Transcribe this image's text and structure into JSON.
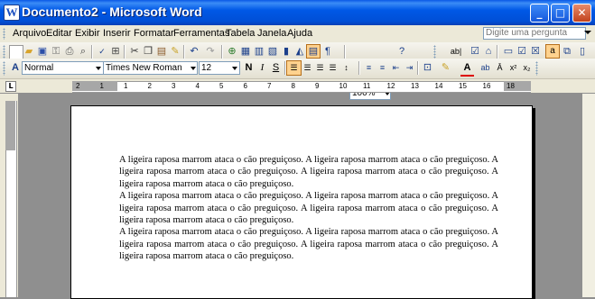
{
  "window": {
    "title": "Documento2 - Microsoft Word",
    "app_icon": "W"
  },
  "menu": {
    "items": [
      "Arquivo",
      "Editar",
      "Exibir",
      "Inserir",
      "Formatar",
      "Ferramentas",
      "Tabela",
      "Janela",
      "Ajuda"
    ],
    "help_placeholder": "Digite uma pergunta"
  },
  "standard_toolbar": {
    "zoom": "100%",
    "leitura": "ab|"
  },
  "formatting_toolbar": {
    "style": "Normal",
    "font": "Times New Roman",
    "size": "12",
    "bold": "N",
    "italic": "I",
    "underline": "S"
  },
  "ruler": {
    "tab_selector": "L",
    "numbers": [
      "2",
      "1",
      "1",
      "2",
      "3",
      "4",
      "5",
      "6",
      "7",
      "8",
      "9",
      "10",
      "11",
      "12",
      "13",
      "14",
      "15",
      "16",
      "18"
    ]
  },
  "document": {
    "paragraphs": [
      "A ligeira raposa marrom ataca o cão preguiçoso.  A ligeira raposa marrom ataca o cão preguiçoso.  A ligeira raposa marrom ataca o cão preguiçoso.  A ligeira raposa marrom ataca o cão preguiçoso.  A ligeira raposa marrom ataca o cão preguiçoso.",
      "A ligeira raposa marrom ataca o cão preguiçoso.  A ligeira raposa marrom ataca o cão preguiçoso.  A ligeira raposa marrom ataca o cão preguiçoso.  A ligeira raposa marrom ataca o cão preguiçoso.  A ligeira raposa marrom ataca o cão preguiçoso.",
      "A ligeira raposa marrom ataca o cão preguiçoso.  A ligeira raposa marrom ataca o cão preguiçoso.  A ligeira raposa marrom ataca o cão preguiçoso.  A ligeira raposa marrom ataca o cão preguiçoso.  A ligeira raposa marrom ataca o cão preguiçoso."
    ]
  },
  "colors": {
    "titlebar": "#0058e6",
    "close_button": "#c2431d",
    "toolbar": "#ece9d8",
    "workspace": "#8f8f8f"
  }
}
